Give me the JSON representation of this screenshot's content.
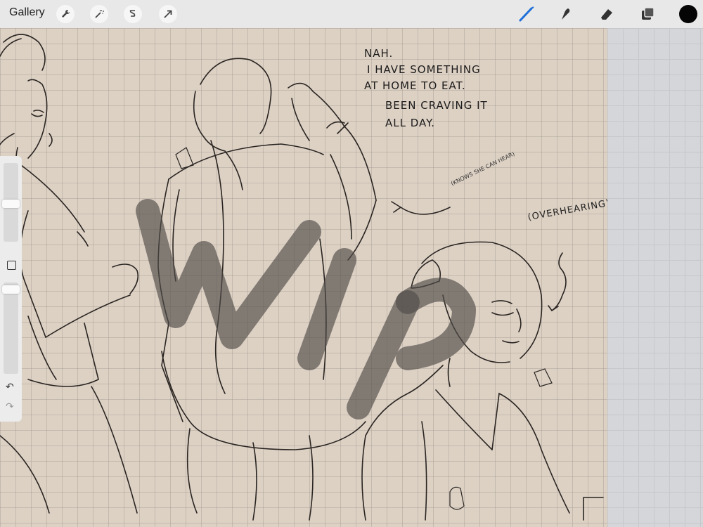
{
  "toolbar": {
    "gallery_label": "Gallery",
    "left_tools": [
      "wrench-icon",
      "magic-wand-icon",
      "selection-icon",
      "transform-arrow-icon"
    ],
    "right_tools": [
      "brush-icon",
      "smudge-icon",
      "eraser-icon",
      "layers-icon"
    ],
    "active_tool": "brush-icon",
    "accent_color": "#1e6fd9",
    "current_color": "#050505"
  },
  "sidebar": {
    "brush_size_level": 0.3,
    "opacity_level": 0.95,
    "undo_icon": "undo-icon",
    "redo_icon": "redo-icon"
  },
  "canvas": {
    "background_color": "#ddd1c4",
    "watermark": "WIP",
    "notes": {
      "line1": "NAH.",
      "line2": "I HAVE SOMETHING",
      "line3": "AT HOME TO EAT.",
      "line4": "BEEN CRAVING IT",
      "line5": "ALL DAY.",
      "aside": "(KNOWS SHE CAN HEAR)",
      "overhearing": "(OVERHEARING)"
    }
  }
}
